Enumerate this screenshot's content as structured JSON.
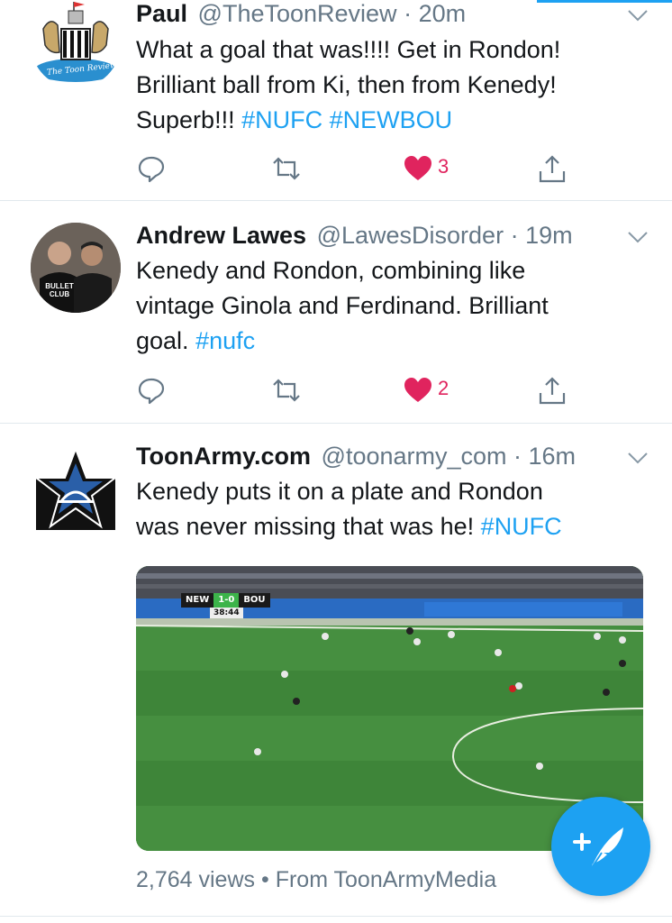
{
  "tweets": [
    {
      "name": "Paul",
      "handle": "@TheToonReview",
      "time": "20m",
      "avatar_text": "The Toon Review",
      "text_lines": [
        {
          "plain": "What a goal that was!!!! Get in Rondon!"
        },
        {
          "plain": "Brilliant ball from Ki, then from Kenedy!"
        },
        {
          "plain": "Superb!!! ",
          "tags": "#NUFC #NEWBOU"
        }
      ],
      "likes": "3"
    },
    {
      "name": "Andrew Lawes",
      "handle": "@LawesDisorder",
      "time": "19m",
      "avatar_text": "BULLET CLUB",
      "text_lines": [
        {
          "plain": "Kenedy and Rondon, combining like"
        },
        {
          "plain": "vintage Ginola and Ferdinand. Brilliant"
        },
        {
          "plain": "goal. ",
          "tags": "#nufc"
        }
      ],
      "likes": "2"
    },
    {
      "name": "ToonArmy.com",
      "handle": "@toonarmy_com",
      "time": "16m",
      "text_lines": [
        {
          "plain": "Kenedy puts it on a plate and Rondon"
        },
        {
          "plain": "was never missing that was he! ",
          "tags": "#NUFC"
        }
      ],
      "media": {
        "score_home": "NEW",
        "score": "1-0",
        "score_away": "BOU",
        "clock": "38:44"
      },
      "views": "2,764 views",
      "source": "From ToonArmyMedia"
    }
  ],
  "separator": " · ",
  "views_dot": " • ",
  "icons": {
    "reply": "reply-icon",
    "retweet": "retweet-icon",
    "like": "heart-icon",
    "share": "share-icon",
    "chevron": "chevron-down-icon",
    "compose": "compose-tweet-icon"
  },
  "colors": {
    "accent": "#1da1f2",
    "like": "#e0245e",
    "muted": "#657786",
    "text": "#14171a"
  }
}
